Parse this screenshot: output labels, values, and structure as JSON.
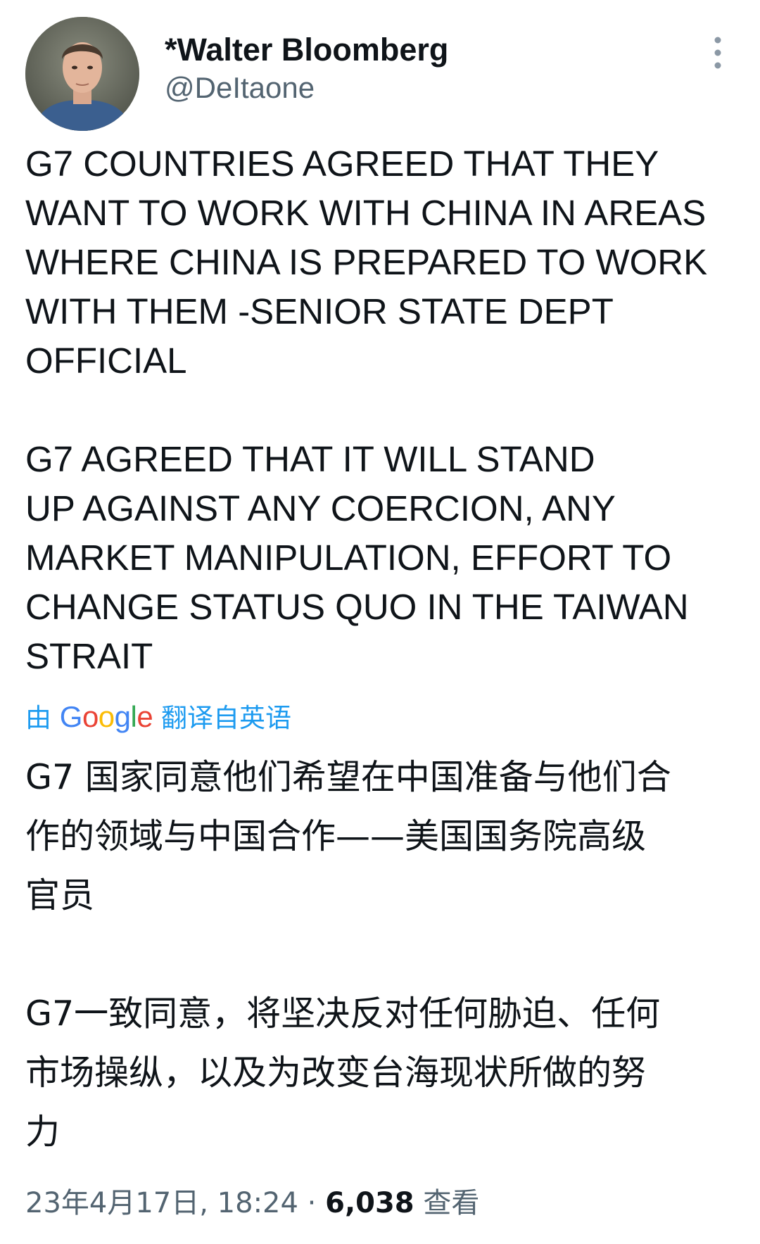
{
  "author": {
    "display_name": "*Walter Bloomberg",
    "handle": "@DeItaone"
  },
  "tweet": {
    "paragraphs": [
      "G7 COUNTRIES AGREED THAT THEY\nWANT TO WORK WITH CHINA IN AREAS\nWHERE CHINA IS PREPARED TO WORK\nWITH THEM -SENIOR STATE DEPT\nOFFICIAL",
      "G7 AGREED THAT IT WILL STAND\nUP AGAINST ANY COERCION, ANY\nMARKET MANIPULATION, EFFORT TO\nCHANGE STATUS QUO IN THE TAIWAN\nSTRAIT"
    ]
  },
  "translation": {
    "prefix": "由",
    "brand": "Google",
    "suffix": "翻译自英语",
    "paragraphs": [
      "G7 国家同意他们希望在中国准备与他们合\n作的领域与中国合作——美国国务院高级\n官员",
      "G7一致同意，将坚决反对任何胁迫、任何\n市场操纵，以及为改变台海现状所做的努\n力"
    ]
  },
  "meta": {
    "timestamp": "23年4月17日, 18:24",
    "separator": "·",
    "views_count": "6,038",
    "views_label": "查看"
  },
  "icons": {
    "more": "more-vertical-icon"
  },
  "colors": {
    "text_primary": "#0f1419",
    "text_secondary": "#536471",
    "link": "#1d9bf0",
    "google_blue": "#4285f4",
    "google_red": "#ea4335",
    "google_yellow": "#fbbc05",
    "google_green": "#34a853"
  }
}
